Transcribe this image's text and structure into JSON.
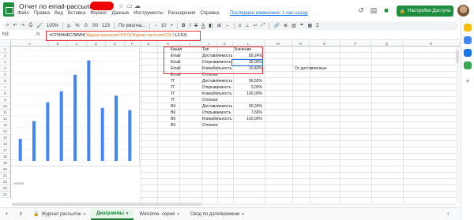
{
  "document": {
    "title": "Отчет по email-рассылкам",
    "last_edit": "Последнее изменение: 1 час назад"
  },
  "menu": [
    "Файл",
    "Правка",
    "Вид",
    "Вставка",
    "Формат",
    "Данные",
    "Инструменты",
    "Расширения",
    "Справка"
  ],
  "header": {
    "share_label": "Настройки Доступа",
    "star_icon": "star-icon",
    "folder_icon": "folder-icon",
    "cloud_icon": "cloud-icon"
  },
  "toolbar": {
    "zoom": "100%",
    "currency": "р.",
    "percent": "%",
    "decimal_dec": ".0",
    "decimal_inc": ".00",
    "number_format": "123",
    "font": "По умолча...",
    "font_size": "10",
    "bold": "B",
    "italic": "I",
    "strike": "S",
    "text_color": "A"
  },
  "formula_bar": {
    "cell_ref": "N3",
    "fx": "fx",
    "formula_prefix": "=СРЗНАЧЕСЛИМН(",
    "formula_ref1": "'Журнал рассылок'!O3:O",
    "formula_sep1": ";",
    "formula_ref2": "'Журнал рассылок'!J3:J",
    "formula_suffix": ";L3;K3)"
  },
  "columns": [
    "A",
    "B",
    "C",
    "D",
    "E",
    "F",
    "G",
    "H",
    "I",
    "J",
    "K",
    "L",
    "M",
    "N",
    "O",
    "P",
    "Q",
    "R"
  ],
  "rows": [
    "1",
    "2",
    "3",
    "4",
    "5",
    "6",
    "7",
    "8",
    "9",
    "10",
    "11",
    "12",
    "13",
    "14",
    "15",
    "16",
    "17",
    "18",
    "19",
    "20",
    "21",
    "22",
    "23",
    "24"
  ],
  "table": {
    "headers": [
      "Канал",
      "Тип",
      "Значение"
    ],
    "rows": [
      [
        "Email",
        "Доставляемость",
        "89,24%"
      ],
      [
        "Email",
        "Открываемость",
        "30,06%"
      ],
      [
        "Email",
        "Кликабельность",
        "10,40%"
      ],
      [
        "Email",
        "Отписки",
        ""
      ],
      [
        "ТГ",
        "Доставляемость",
        "96,55%"
      ],
      [
        "ТГ",
        "Открываемость",
        "0,00%"
      ],
      [
        "ТГ",
        "Кликабельность",
        "100,00%"
      ],
      [
        "ТГ",
        "Отписки",
        ""
      ],
      [
        "ВК",
        "Доставляемость",
        "90,34%"
      ],
      [
        "ВК",
        "Открываемость",
        "7,66%"
      ],
      [
        "ВК",
        "Кликабельность",
        "100,00%"
      ],
      [
        "ВК",
        "Отписки",
        ""
      ]
    ],
    "note": "От доставленных"
  },
  "chart_data": {
    "type": "bar",
    "values": [
      20,
      36,
      53,
      63,
      78,
      91,
      48,
      59,
      46
    ],
    "ylim": [
      0,
      100
    ],
    "color": "#4285f4"
  },
  "chart2_label": "ности",
  "sheet_tabs": [
    {
      "label": "Журнал рассылок",
      "active": false
    },
    {
      "label": "Диаграммы",
      "active": true
    },
    {
      "label": "Welcome- серия",
      "active": false
    },
    {
      "label": "Свод по дате/времени",
      "active": false
    }
  ],
  "tab_icons": {
    "add": "+",
    "list": "≡",
    "explore": "‹"
  },
  "colors": {
    "accent_green": "#1e8e3e",
    "highlight_red": "#e8323c",
    "bar_blue": "#4285f4",
    "link_blue": "#1a73e8"
  }
}
